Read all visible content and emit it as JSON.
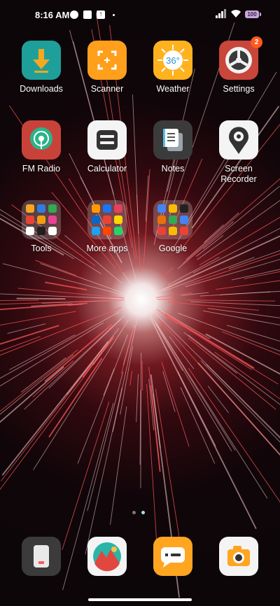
{
  "status_bar": {
    "time": "8:16 AM",
    "battery": "100"
  },
  "apps": [
    {
      "id": "downloads",
      "label": "Downloads",
      "badge": ""
    },
    {
      "id": "scanner",
      "label": "Scanner",
      "badge": ""
    },
    {
      "id": "weather",
      "label": "Weather",
      "badge": "",
      "temp": "36°"
    },
    {
      "id": "settings",
      "label": "Settings",
      "badge": "2"
    },
    {
      "id": "fm-radio",
      "label": "FM Radio",
      "badge": ""
    },
    {
      "id": "calculator",
      "label": "Calculator",
      "badge": ""
    },
    {
      "id": "notes",
      "label": "Notes",
      "badge": ""
    },
    {
      "id": "screen-recorder",
      "label": "Screen\nRecorder",
      "badge": ""
    }
  ],
  "folders": [
    {
      "id": "tools",
      "label": "Tools",
      "minis": [
        "#f5a623",
        "#2e7de1",
        "#34a853",
        "#ea4335",
        "#f39c12",
        "#e84393",
        "#ffffff",
        "#1f1f1f",
        "#ffffff"
      ]
    },
    {
      "id": "more-apps",
      "label": "More apps",
      "minis": [
        "#ff9900",
        "#1877f2",
        "#e4405f",
        "#0a66c2",
        "#ea4335",
        "#ffd400",
        "#1da1f2",
        "#ff4500",
        "#25d366"
      ]
    },
    {
      "id": "google",
      "label": "Google",
      "minis": [
        "#4285f4",
        "#fbbc05",
        "#222222",
        "#e8710a",
        "#34a853",
        "#4285f4",
        "#ea4335",
        "#fbbc05",
        "#ea4335"
      ]
    }
  ],
  "dock": [
    {
      "id": "phone-manager"
    },
    {
      "id": "gallery"
    },
    {
      "id": "messages"
    },
    {
      "id": "camera"
    }
  ],
  "page_indicator": {
    "pages": 2,
    "current": 2
  }
}
